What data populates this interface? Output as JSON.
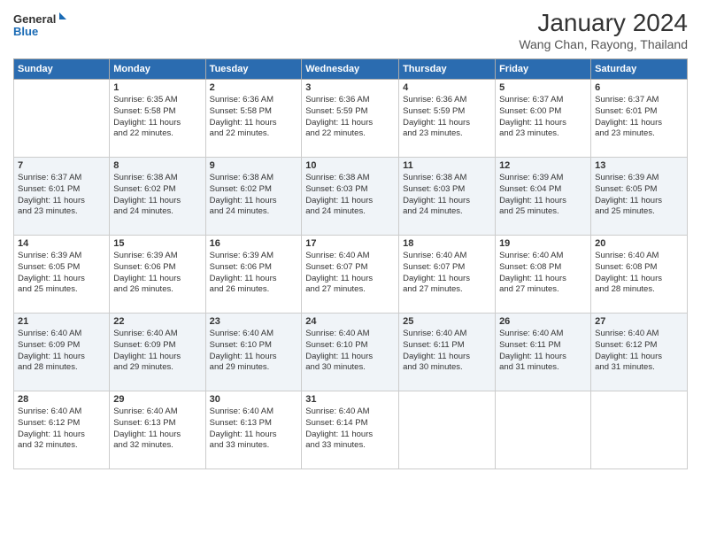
{
  "logo": {
    "line1": "General",
    "line2": "Blue"
  },
  "title": "January 2024",
  "location": "Wang Chan, Rayong, Thailand",
  "days_header": [
    "Sunday",
    "Monday",
    "Tuesday",
    "Wednesday",
    "Thursday",
    "Friday",
    "Saturday"
  ],
  "weeks": [
    [
      {
        "num": "",
        "text": ""
      },
      {
        "num": "1",
        "text": "Sunrise: 6:35 AM\nSunset: 5:58 PM\nDaylight: 11 hours\nand 22 minutes."
      },
      {
        "num": "2",
        "text": "Sunrise: 6:36 AM\nSunset: 5:58 PM\nDaylight: 11 hours\nand 22 minutes."
      },
      {
        "num": "3",
        "text": "Sunrise: 6:36 AM\nSunset: 5:59 PM\nDaylight: 11 hours\nand 22 minutes."
      },
      {
        "num": "4",
        "text": "Sunrise: 6:36 AM\nSunset: 5:59 PM\nDaylight: 11 hours\nand 23 minutes."
      },
      {
        "num": "5",
        "text": "Sunrise: 6:37 AM\nSunset: 6:00 PM\nDaylight: 11 hours\nand 23 minutes."
      },
      {
        "num": "6",
        "text": "Sunrise: 6:37 AM\nSunset: 6:01 PM\nDaylight: 11 hours\nand 23 minutes."
      }
    ],
    [
      {
        "num": "7",
        "text": "Sunrise: 6:37 AM\nSunset: 6:01 PM\nDaylight: 11 hours\nand 23 minutes."
      },
      {
        "num": "8",
        "text": "Sunrise: 6:38 AM\nSunset: 6:02 PM\nDaylight: 11 hours\nand 24 minutes."
      },
      {
        "num": "9",
        "text": "Sunrise: 6:38 AM\nSunset: 6:02 PM\nDaylight: 11 hours\nand 24 minutes."
      },
      {
        "num": "10",
        "text": "Sunrise: 6:38 AM\nSunset: 6:03 PM\nDaylight: 11 hours\nand 24 minutes."
      },
      {
        "num": "11",
        "text": "Sunrise: 6:38 AM\nSunset: 6:03 PM\nDaylight: 11 hours\nand 24 minutes."
      },
      {
        "num": "12",
        "text": "Sunrise: 6:39 AM\nSunset: 6:04 PM\nDaylight: 11 hours\nand 25 minutes."
      },
      {
        "num": "13",
        "text": "Sunrise: 6:39 AM\nSunset: 6:05 PM\nDaylight: 11 hours\nand 25 minutes."
      }
    ],
    [
      {
        "num": "14",
        "text": "Sunrise: 6:39 AM\nSunset: 6:05 PM\nDaylight: 11 hours\nand 25 minutes."
      },
      {
        "num": "15",
        "text": "Sunrise: 6:39 AM\nSunset: 6:06 PM\nDaylight: 11 hours\nand 26 minutes."
      },
      {
        "num": "16",
        "text": "Sunrise: 6:39 AM\nSunset: 6:06 PM\nDaylight: 11 hours\nand 26 minutes."
      },
      {
        "num": "17",
        "text": "Sunrise: 6:40 AM\nSunset: 6:07 PM\nDaylight: 11 hours\nand 27 minutes."
      },
      {
        "num": "18",
        "text": "Sunrise: 6:40 AM\nSunset: 6:07 PM\nDaylight: 11 hours\nand 27 minutes."
      },
      {
        "num": "19",
        "text": "Sunrise: 6:40 AM\nSunset: 6:08 PM\nDaylight: 11 hours\nand 27 minutes."
      },
      {
        "num": "20",
        "text": "Sunrise: 6:40 AM\nSunset: 6:08 PM\nDaylight: 11 hours\nand 28 minutes."
      }
    ],
    [
      {
        "num": "21",
        "text": "Sunrise: 6:40 AM\nSunset: 6:09 PM\nDaylight: 11 hours\nand 28 minutes."
      },
      {
        "num": "22",
        "text": "Sunrise: 6:40 AM\nSunset: 6:09 PM\nDaylight: 11 hours\nand 29 minutes."
      },
      {
        "num": "23",
        "text": "Sunrise: 6:40 AM\nSunset: 6:10 PM\nDaylight: 11 hours\nand 29 minutes."
      },
      {
        "num": "24",
        "text": "Sunrise: 6:40 AM\nSunset: 6:10 PM\nDaylight: 11 hours\nand 30 minutes."
      },
      {
        "num": "25",
        "text": "Sunrise: 6:40 AM\nSunset: 6:11 PM\nDaylight: 11 hours\nand 30 minutes."
      },
      {
        "num": "26",
        "text": "Sunrise: 6:40 AM\nSunset: 6:11 PM\nDaylight: 11 hours\nand 31 minutes."
      },
      {
        "num": "27",
        "text": "Sunrise: 6:40 AM\nSunset: 6:12 PM\nDaylight: 11 hours\nand 31 minutes."
      }
    ],
    [
      {
        "num": "28",
        "text": "Sunrise: 6:40 AM\nSunset: 6:12 PM\nDaylight: 11 hours\nand 32 minutes."
      },
      {
        "num": "29",
        "text": "Sunrise: 6:40 AM\nSunset: 6:13 PM\nDaylight: 11 hours\nand 32 minutes."
      },
      {
        "num": "30",
        "text": "Sunrise: 6:40 AM\nSunset: 6:13 PM\nDaylight: 11 hours\nand 33 minutes."
      },
      {
        "num": "31",
        "text": "Sunrise: 6:40 AM\nSunset: 6:14 PM\nDaylight: 11 hours\nand 33 minutes."
      },
      {
        "num": "",
        "text": ""
      },
      {
        "num": "",
        "text": ""
      },
      {
        "num": "",
        "text": ""
      }
    ]
  ]
}
